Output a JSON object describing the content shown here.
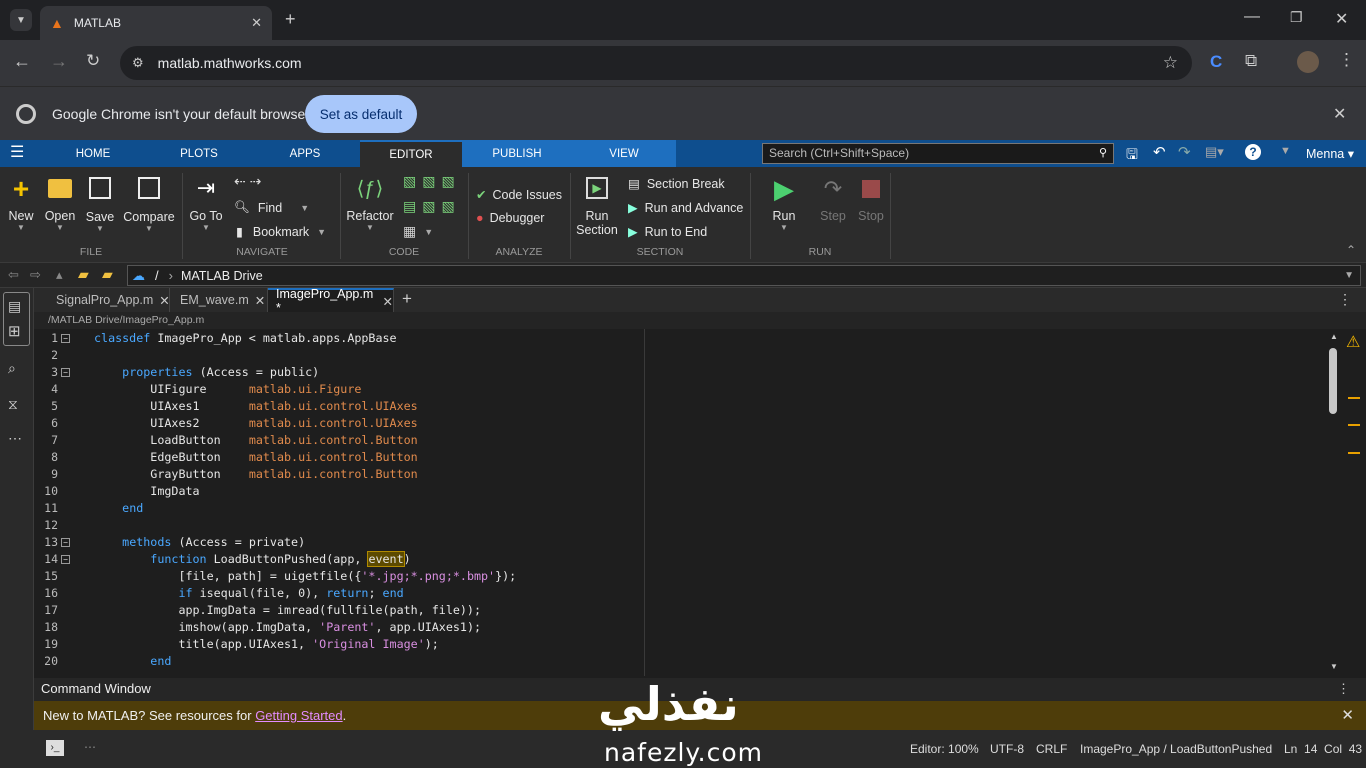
{
  "browser": {
    "tab_title": "MATLAB",
    "url": "matlab.mathworks.com",
    "infobar_text": "Google Chrome isn't your default browser",
    "set_default": "Set as default"
  },
  "matlab": {
    "tabs": [
      "HOME",
      "PLOTS",
      "APPS",
      "EDITOR",
      "PUBLISH",
      "VIEW"
    ],
    "search_placeholder": "Search (Ctrl+Shift+Space)",
    "user": "Menna",
    "file_group": {
      "label": "FILE",
      "new": "New",
      "open": "Open",
      "save": "Save",
      "compare": "Compare"
    },
    "navigate_group": {
      "label": "NAVIGATE",
      "goto": "Go To",
      "find": "Find",
      "bookmark": "Bookmark"
    },
    "code_group": {
      "label": "CODE",
      "refactor": "Refactor"
    },
    "analyze_group": {
      "label": "ANALYZE",
      "code_issues": "Code Issues",
      "debugger": "Debugger"
    },
    "section_group": {
      "label": "SECTION",
      "run_section_1": "Run",
      "run_section_2": "Section",
      "section_break": "Section Break",
      "run_advance": "Run and Advance",
      "run_end": "Run to End"
    },
    "run_group": {
      "label": "RUN",
      "run": "Run",
      "step": "Step",
      "stop": "Stop"
    },
    "address": {
      "root": "/",
      "folder": "MATLAB Drive"
    },
    "file_tabs": [
      "SignalPro_App.m",
      "EM_wave.m",
      "ImagePro_App.m *"
    ],
    "file_path": "/MATLAB Drive/ImagePro_App.m",
    "command_window": "Command Window",
    "banner_text": "New to MATLAB? See resources for ",
    "banner_link": "Getting Started",
    "banner_end": ".",
    "status": {
      "zoom": "Editor: 100%",
      "encoding": "UTF-8",
      "eol": "CRLF",
      "context": "ImagePro_App / LoadButtonPushed",
      "position": "Ln  14  Col  43"
    }
  },
  "code_lines": [
    "1",
    "2",
    "3",
    "4",
    "5",
    "6",
    "7",
    "8",
    "9",
    "10",
    "11",
    "12",
    "13",
    "14",
    "15",
    "16",
    "17",
    "18",
    "19",
    "20"
  ],
  "watermark": {
    "arabic": "نفذلي",
    "latin": "nafezly.com"
  }
}
